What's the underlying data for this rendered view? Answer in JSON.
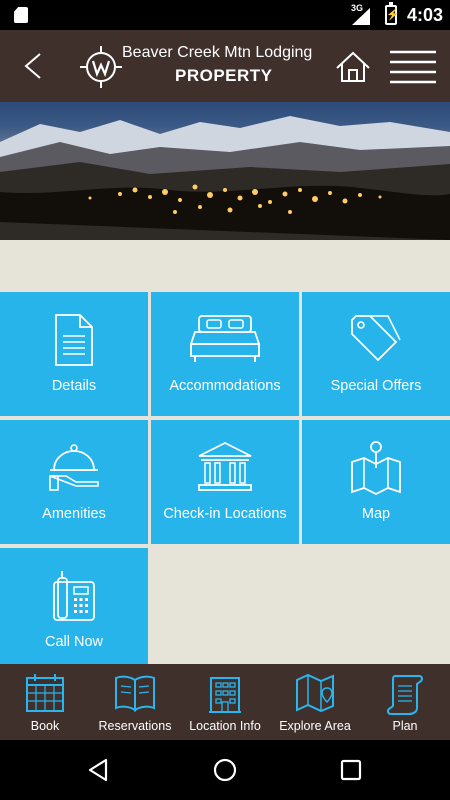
{
  "status_bar": {
    "network": "3G",
    "time": "4:03"
  },
  "header": {
    "title": "Beaver Creek Mtn Lodging",
    "subtitle": "PROPERTY"
  },
  "tiles": [
    {
      "label": "Details",
      "icon": "document-icon"
    },
    {
      "label": "Accommodations",
      "icon": "bed-icon"
    },
    {
      "label": "Special Offers",
      "icon": "tag-icon"
    },
    {
      "label": "Amenities",
      "icon": "service-bell-icon"
    },
    {
      "label": "Check-in Locations",
      "icon": "building-columns-icon"
    },
    {
      "label": "Map",
      "icon": "map-pin-icon"
    },
    {
      "label": "Call Now",
      "icon": "phone-icon"
    }
  ],
  "bottom_nav": [
    {
      "label": "Book",
      "icon": "calendar-icon"
    },
    {
      "label": "Reservations",
      "icon": "book-icon"
    },
    {
      "label": "Location Info",
      "icon": "building-icon"
    },
    {
      "label": "Explore Area",
      "icon": "map-icon"
    },
    {
      "label": "Plan",
      "icon": "scroll-icon"
    }
  ],
  "colors": {
    "header_bg": "#3f302c",
    "tile_bg": "#27b4ea",
    "pattern_bg": "#e6e4d8"
  }
}
